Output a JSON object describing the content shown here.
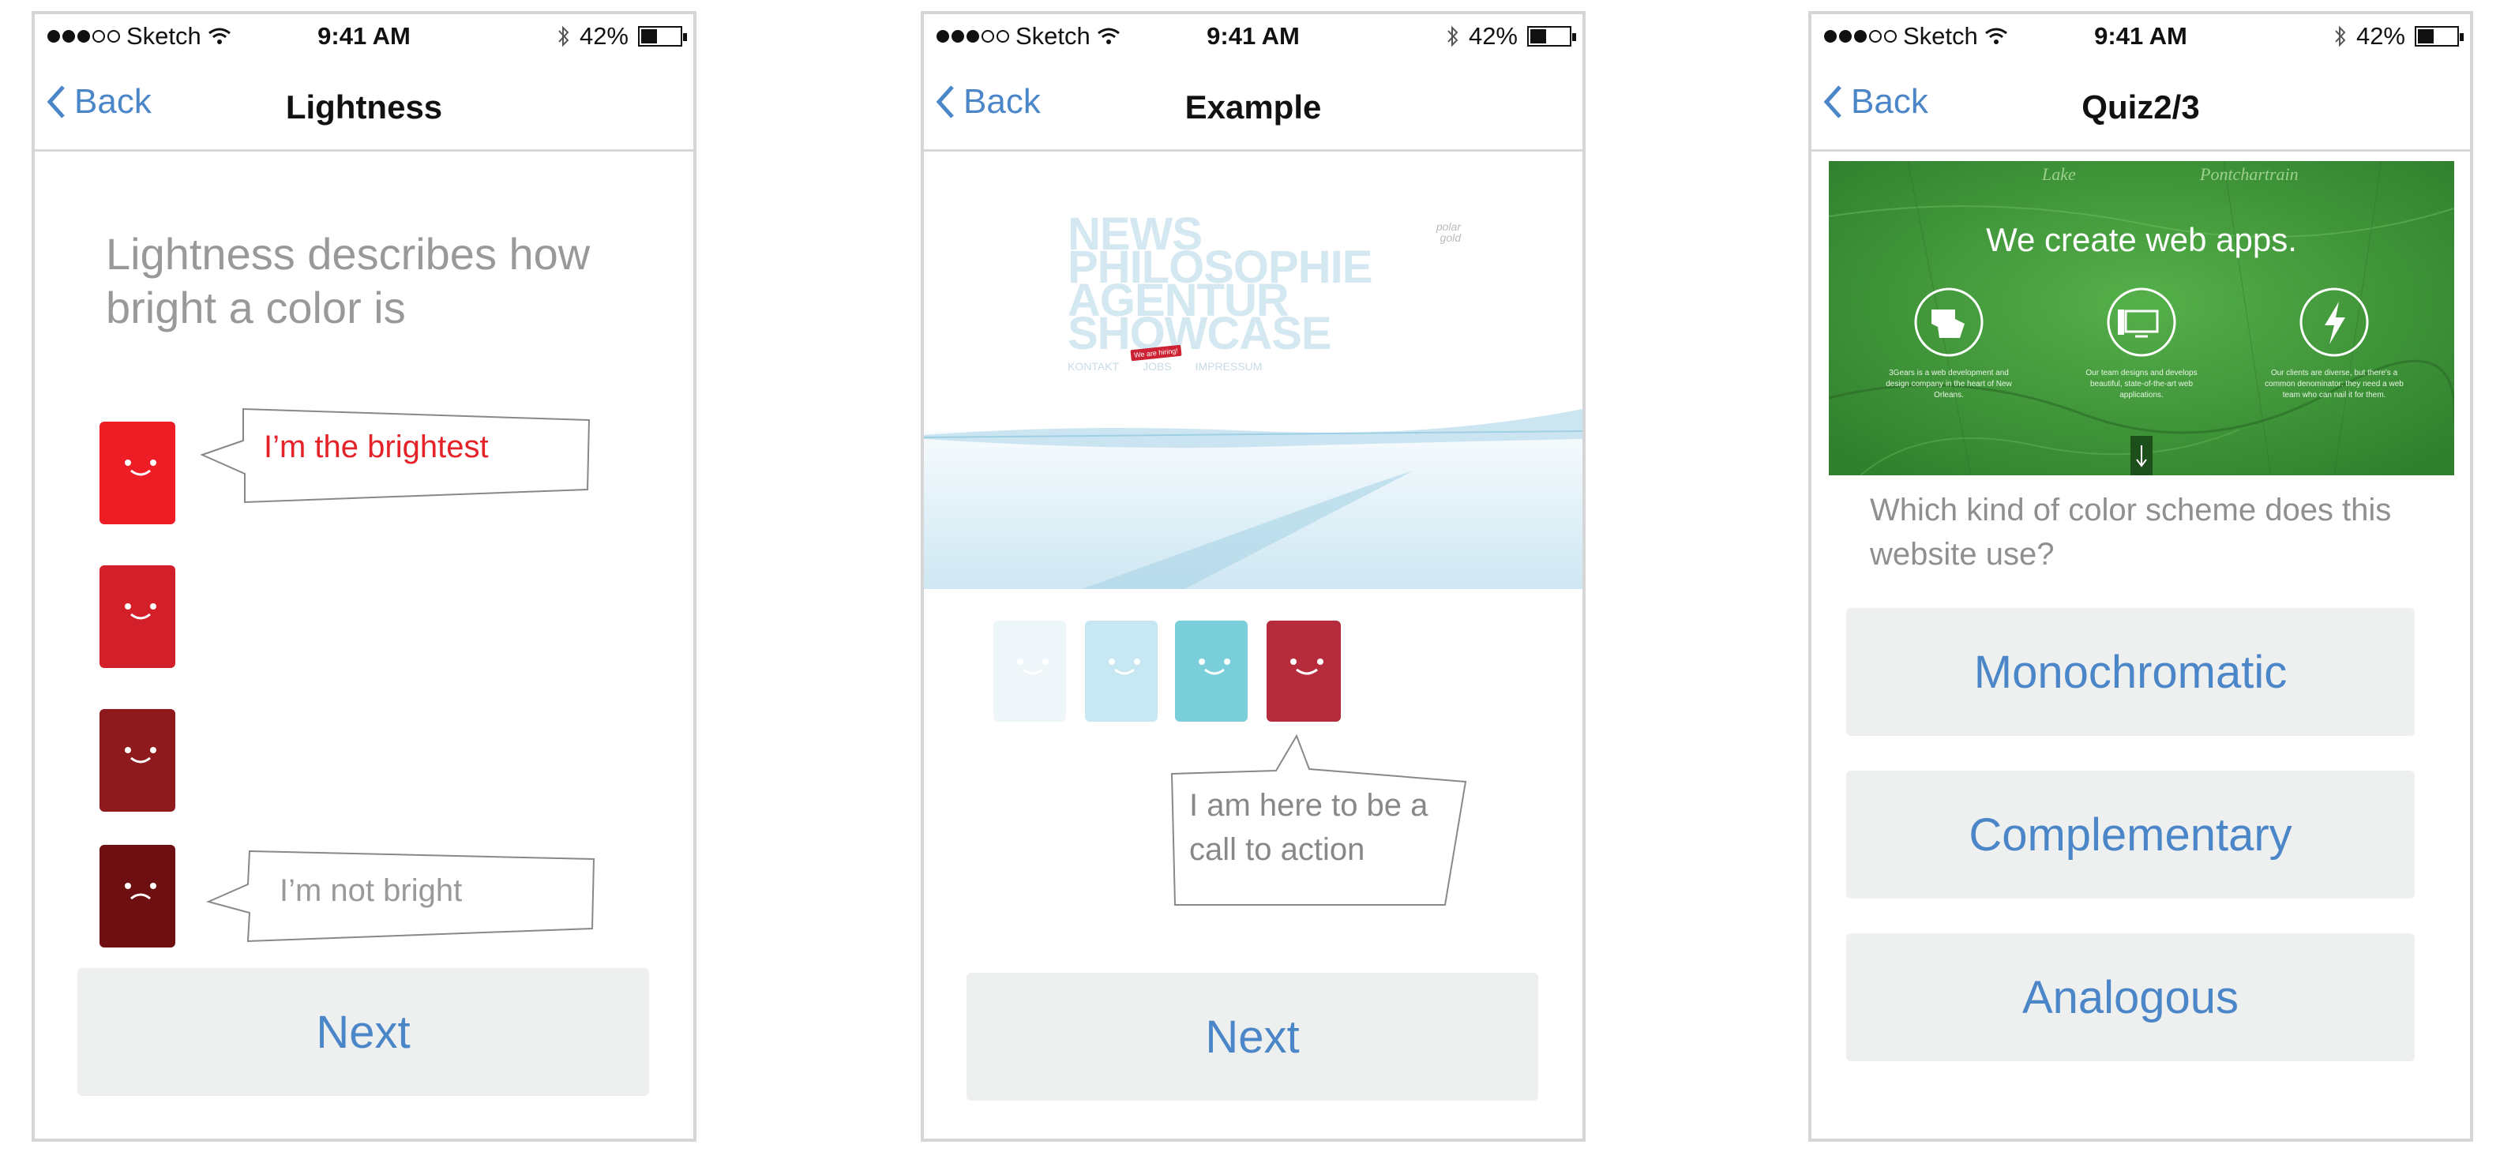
{
  "status_bar": {
    "carrier": "Sketch",
    "time": "9:41 AM",
    "battery": "42%",
    "battery_level": 0.42
  },
  "screens": [
    {
      "back_label": "Back",
      "title": "Lightness",
      "body": "Lightness describes how bright a color is",
      "bubble_top": "I’m the brightest",
      "bubble_bottom": "I’m not bright",
      "card_colors": [
        "#ee1c25",
        "#d21f2a",
        "#8e1a1d",
        "#6e0f12"
      ],
      "next_label": "Next"
    },
    {
      "back_label": "Back",
      "title": "Example",
      "example_site": {
        "menu_lines": [
          "NEWS",
          "PHILOSOPHIE",
          "AGENTUR",
          "SHOWCASE"
        ],
        "nav_links": [
          "KONTAKT",
          "JOBS",
          "IMPRESSUM"
        ],
        "badge": "We are hiring!",
        "logo": "polar gold"
      },
      "card_colors": [
        "#eef6f9",
        "#c7e8f2",
        "#7bcfdb",
        "#b72c3d"
      ],
      "bubble": "I am here to be a call to action",
      "next_label": "Next"
    },
    {
      "back_label": "Back",
      "title": "Quiz2/3",
      "website": {
        "map_labels": [
          "Lake",
          "Pontchartrain"
        ],
        "headline": "We create web apps.",
        "features": [
          "3Gears is a web development and design company in the heart of New Orleans.",
          "Our team designs and develops beautiful, state-of-the-art web applications.",
          "Our clients are diverse, but there's a common denominator: they need a web team who can nail it for them."
        ]
      },
      "question": "Which kind of color scheme does this website use?",
      "answers": [
        "Monochromatic",
        "Complementary",
        "Analogous"
      ]
    }
  ]
}
